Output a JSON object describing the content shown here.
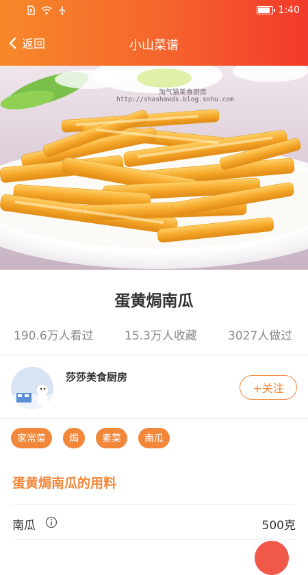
{
  "status_bar": {
    "time": "1:40",
    "battery_level": 0.8,
    "icons": [
      "sim-card-icon",
      "wifi-icon",
      "usb-icon",
      "battery-icon"
    ]
  },
  "navbar": {
    "back_label": "返回",
    "title": "小山菜谱"
  },
  "hero": {
    "watermark_line1": "淘气猫美食厨房",
    "watermark_line2": "http://shashawds.blog.sohu.com"
  },
  "recipe": {
    "title": "蛋黄焗南瓜",
    "stats": {
      "views": "190.6万人看过",
      "favorites": "15.3万人收藏",
      "made": "3027人做过"
    }
  },
  "author": {
    "name": "莎莎美食厨房",
    "follow_label": "+关注"
  },
  "tags": [
    "家常菜",
    "焗",
    "素菜",
    "南瓜"
  ],
  "ingredients": {
    "section_title": "蛋黄焗南瓜的用料",
    "items": [
      {
        "name": "南瓜",
        "amount": "500克"
      }
    ]
  },
  "colors": {
    "accent": "#f2873a",
    "header_start": "#f7892a",
    "header_end": "#f23a2b",
    "fab": "#f0584a"
  }
}
